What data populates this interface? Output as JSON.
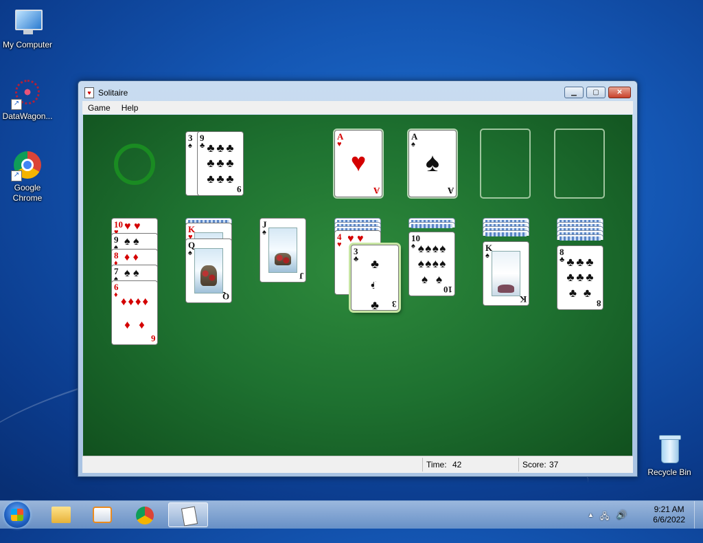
{
  "desktop": {
    "icons": [
      {
        "label": "My Computer"
      },
      {
        "label": "DataWagon..."
      },
      {
        "label": "Google Chrome"
      },
      {
        "label": "Recycle Bin"
      }
    ]
  },
  "window": {
    "title": "Solitaire",
    "menu": [
      "Game",
      "Help"
    ],
    "controls": {
      "minimize": "▁",
      "maximize": "▢",
      "close": "✕"
    }
  },
  "game": {
    "stock_icon": "empty-stock-ring",
    "waste": {
      "top": {
        "rank": "9",
        "suit": "♣"
      },
      "under": {
        "rank": "3",
        "suit": "♠"
      }
    },
    "foundations": [
      {
        "rank": "A",
        "suit": "♥",
        "color": "red"
      },
      {
        "rank": "A",
        "suit": "♠",
        "color": "black"
      },
      {
        "empty": true
      },
      {
        "empty": true
      }
    ],
    "tableau": [
      {
        "cards": [
          {
            "rank": "10",
            "suit": "♥",
            "color": "red"
          },
          {
            "rank": "9",
            "suit": "♠",
            "color": "black"
          },
          {
            "rank": "8",
            "suit": "♦",
            "color": "red"
          },
          {
            "rank": "7",
            "suit": "♠",
            "color": "black"
          },
          {
            "rank": "6",
            "suit": "♦",
            "color": "red"
          }
        ]
      },
      {
        "hidden": 1,
        "cards": [
          {
            "rank": "K",
            "suit": "♥",
            "color": "red"
          },
          {
            "rank": "Q",
            "suit": "♠",
            "color": "black"
          }
        ]
      },
      {
        "hidden": 0,
        "cards": [
          {
            "rank": "J",
            "suit": "♠",
            "color": "black"
          }
        ]
      },
      {
        "hidden": 3,
        "cards": [
          {
            "rank": "4",
            "suit": "♥",
            "color": "red"
          }
        ]
      },
      {
        "hidden": 2,
        "cards": [
          {
            "rank": "10",
            "suit": "♠",
            "color": "black"
          }
        ]
      },
      {
        "hidden": 4,
        "cards": [
          {
            "rank": "K",
            "suit": "♠",
            "color": "black"
          }
        ]
      },
      {
        "hidden": 5,
        "cards": [
          {
            "rank": "8",
            "suit": "♣",
            "color": "black"
          }
        ]
      }
    ],
    "dragged_card": {
      "rank": "3",
      "suit": "♣",
      "color": "black"
    }
  },
  "status": {
    "time_label": "Time:",
    "time_value": "42",
    "score_label": "Score:",
    "score_value": "37"
  },
  "taskbar": {
    "clock_time": "9:21 AM",
    "clock_date": "6/6/2022",
    "tray_arrow": "▲"
  }
}
